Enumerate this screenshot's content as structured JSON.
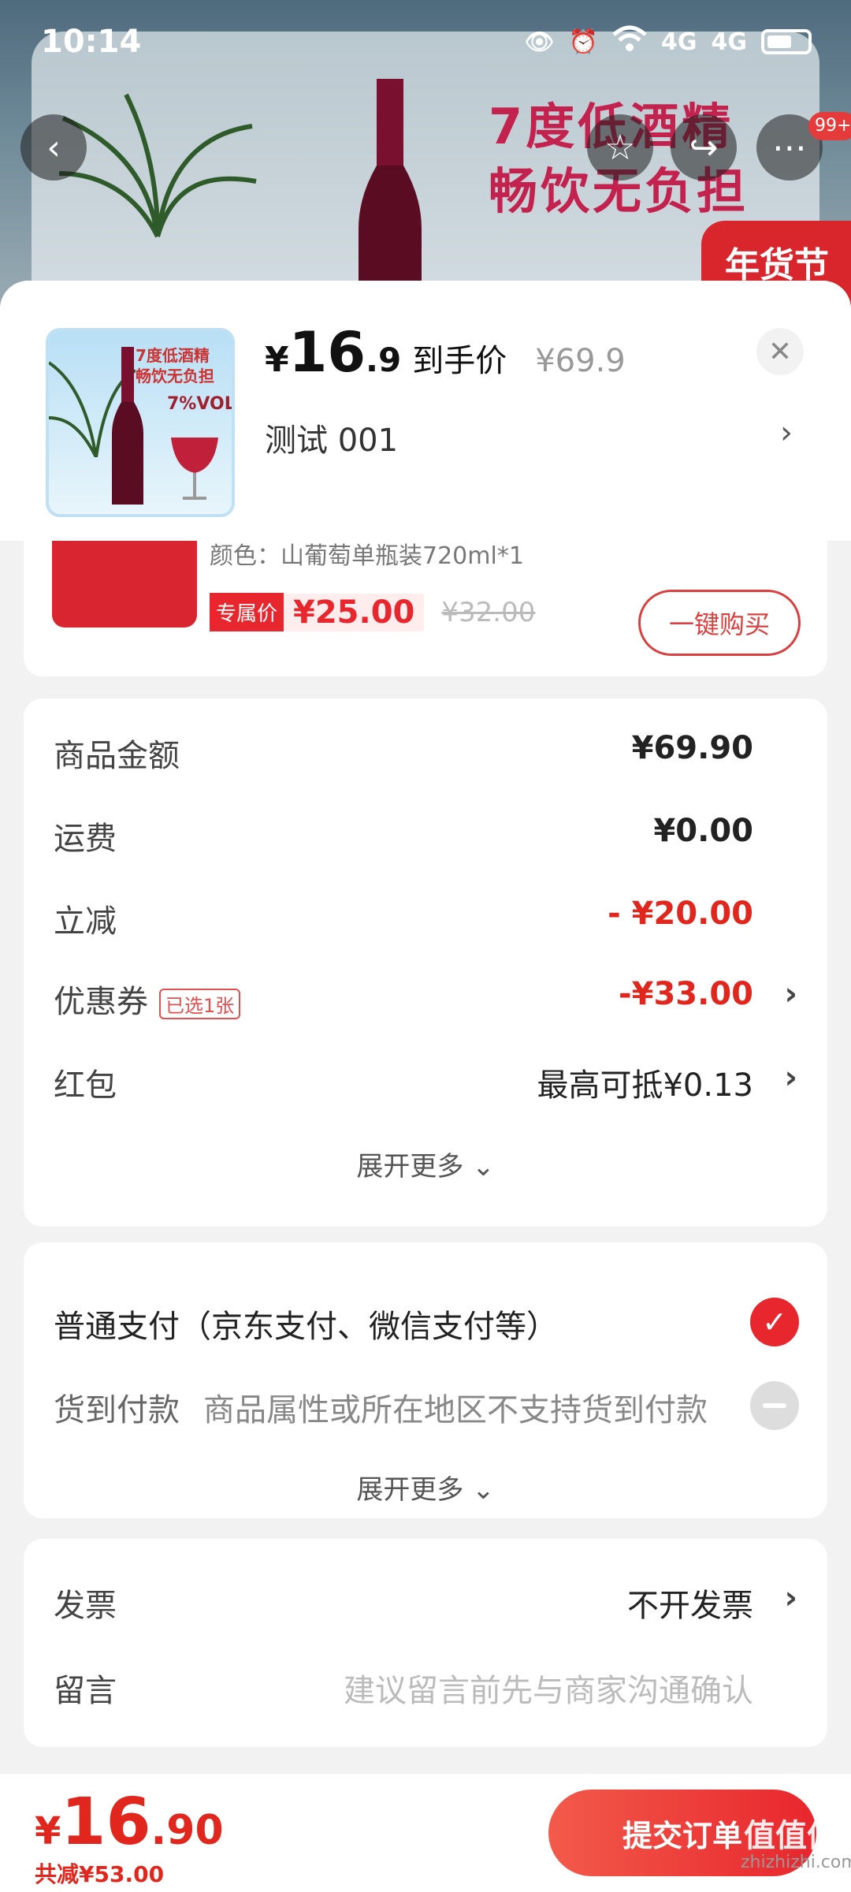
{
  "status_bar": {
    "time": "10:14",
    "net1": "4G",
    "net2": "4G"
  },
  "banner": {
    "headline_1": "7度低酒精",
    "headline_2": "畅饮无负担",
    "tag": "年货节",
    "badge": "99+"
  },
  "sheet": {
    "price_yen": "¥",
    "price_int": "16",
    "price_dec": ".9",
    "price_label": "到手价",
    "original_price": "¥69.9",
    "sku": "测试  001"
  },
  "thumb": {
    "text": "7度低酒精\n畅饮无负担",
    "vol": "7%VOL"
  },
  "product": {
    "spec": "颜色：山葡萄单瓶装720ml*1",
    "exclusive_label": "专属价",
    "exclusive_price": "¥25.00",
    "orig_price": "¥32.00",
    "buy_button": "一键购买"
  },
  "summary": {
    "goods_label": "商品金额",
    "goods_value": "¥69.90",
    "shipping_label": "运费",
    "shipping_value": "¥0.00",
    "discount_label": "立减",
    "discount_value": "- ¥20.00",
    "coupon_label": "优惠券",
    "coupon_tag": "已选1张",
    "coupon_value": "-¥33.00",
    "redpacket_label": "红包",
    "redpacket_value": "最高可抵¥0.13",
    "expand": "展开更多"
  },
  "payment": {
    "normal_label": "普通支付（京东支付、微信支付等）",
    "cod_label": "货到付款",
    "cod_note": "商品属性或所在地区不支持货到付款",
    "expand": "展开更多"
  },
  "invoice": {
    "invoice_label": "发票",
    "invoice_value": "不开发票",
    "message_label": "留言",
    "message_placeholder": "建议留言前先与商家沟通确认"
  },
  "bottom": {
    "total_yen": "¥",
    "total_int": "16",
    "total_dec": ".90",
    "saved": "共减¥53.00",
    "submit": "提交订单",
    "watermark": "zhizhizhi.com",
    "logo": "值值值"
  },
  "colors": {
    "accent": "#e8262d",
    "text": "#222222",
    "muted": "#888888"
  }
}
